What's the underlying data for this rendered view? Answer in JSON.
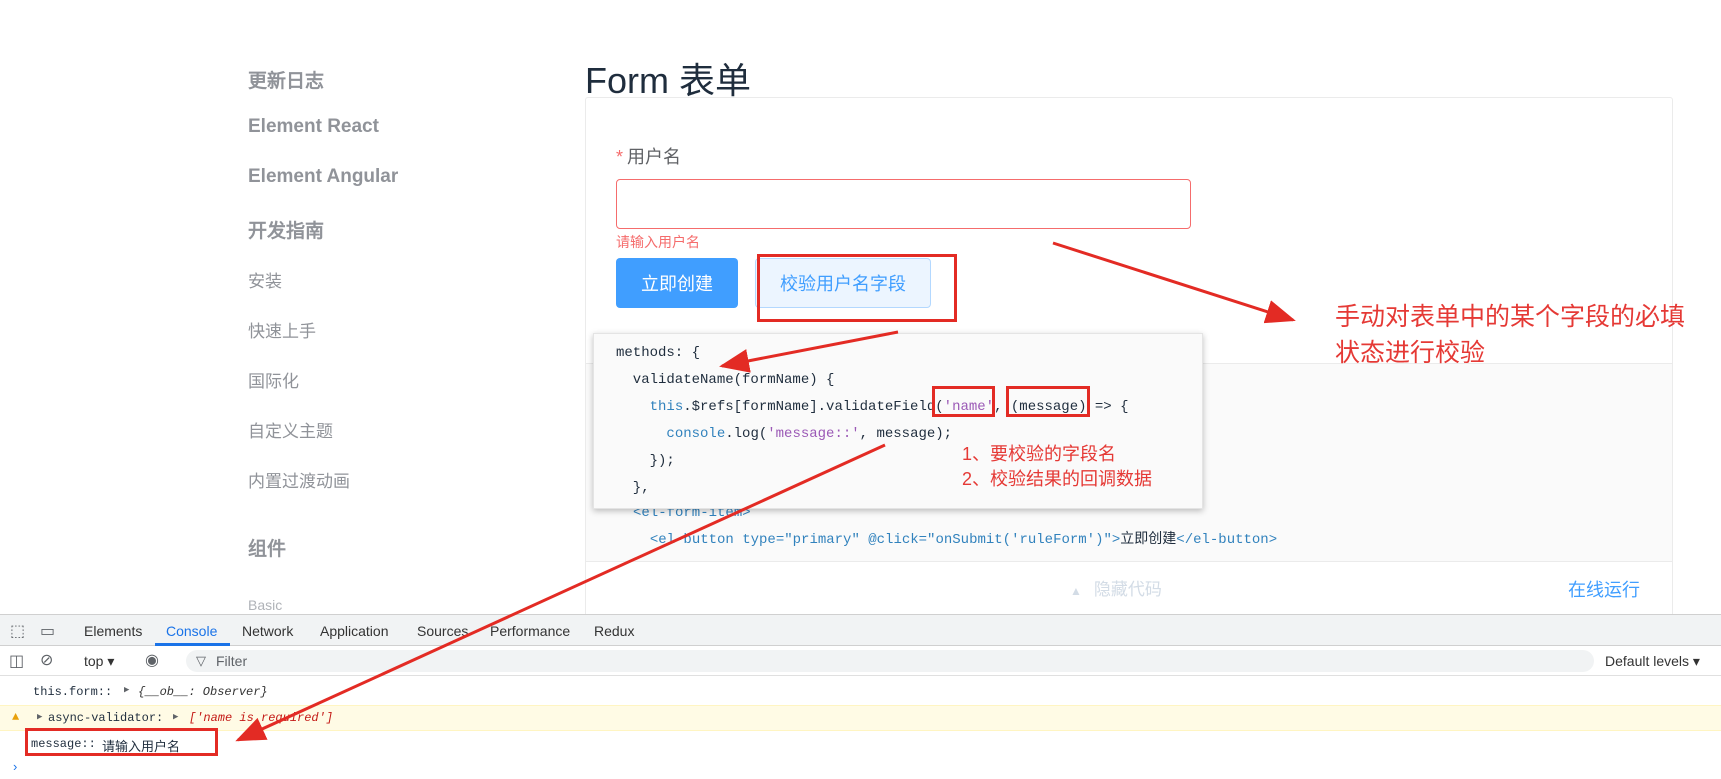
{
  "sidebar": {
    "groups": [
      "更新日志",
      "Element React",
      "Element Angular",
      "开发指南",
      "组件"
    ],
    "links": [
      "安装",
      "快速上手",
      "国际化",
      "自定义主题",
      "内置过渡动画"
    ],
    "sub": "Basic"
  },
  "page": {
    "title": "Form 表单"
  },
  "form": {
    "required_mark": "*",
    "label": "用户名",
    "input_value": "",
    "error": "请输入用户名",
    "submit_label": "立即创建",
    "validate_label": "校验用户名字段"
  },
  "code": {
    "line_item": "<el-form-item>",
    "line_btn_pre": "<el-button type=\"primary\" @click=\"onSubmit('ruleForm')\">",
    "line_btn_txt": "立即创建",
    "line_btn_post": "</el-button>"
  },
  "demo_footer": {
    "hide_code": "隐藏代码",
    "run_online": "在线运行"
  },
  "popup": {
    "line1": "methods: {",
    "line2": "  validateName(formName) {",
    "line3_kw": "this",
    "line3_a": ".$refs[formName].validateField(",
    "line3_str": "'name'",
    "line3_b": ", (message) => {",
    "line4_kw": "console",
    "line4_a": ".log(",
    "line4_str": "'message::'",
    "line4_b": ", message);",
    "line5": "    });",
    "line6": "  },"
  },
  "annotations": {
    "main_line1": "手动对表单中的某个字段的必填",
    "main_line2": "状态进行校验",
    "note1": "1、要校验的字段名",
    "note2": "2、校验结果的回调数据"
  },
  "devtools": {
    "tabs": [
      "Elements",
      "Console",
      "Network",
      "Application",
      "Sources",
      "Performance",
      "Redux"
    ],
    "active_tab": "Console",
    "context": "top ▾",
    "filter_placeholder": "Filter",
    "levels": "Default levels ▾",
    "logs": [
      {
        "label": "this.form::",
        "value": "{__ob__: Observer}"
      },
      {
        "label": "async-validator:",
        "value": "['name is required']"
      },
      {
        "label": "message::",
        "value": "请输入用户名"
      }
    ]
  },
  "colors": {
    "accent": "#409eff",
    "error": "#f56c6c",
    "annotation": "#e32b24",
    "devtools_active": "#1a73e8"
  }
}
